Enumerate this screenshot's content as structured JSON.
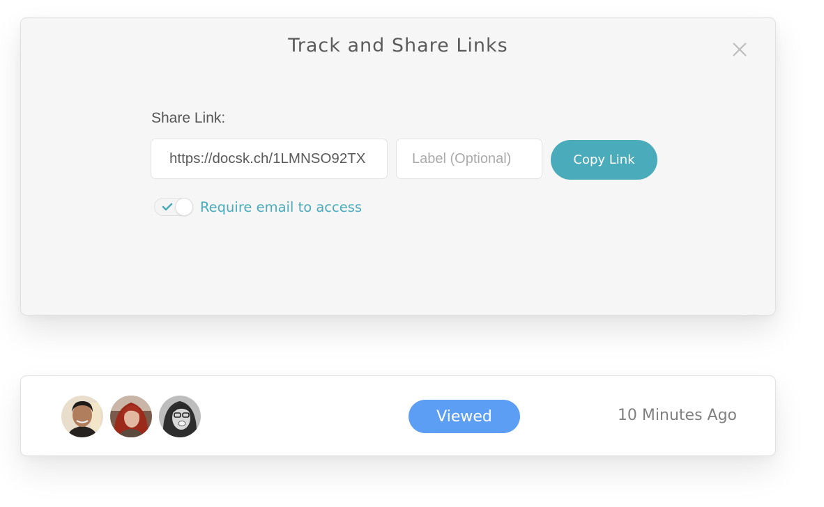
{
  "modal": {
    "title": "Track and Share Links",
    "close_icon": "close-icon",
    "share_label": "Share Link:",
    "url_value": "https://docsk.ch/1LMNSO92TX",
    "label_placeholder": "Label (Optional)",
    "label_value": "",
    "copy_button": "Copy Link",
    "require_email": {
      "label": "Require email to access",
      "checked": true
    }
  },
  "activity": {
    "avatars": [
      {
        "name": "avatar-man-dark-hair"
      },
      {
        "name": "avatar-woman-red-hair"
      },
      {
        "name": "avatar-woman-glasses"
      }
    ],
    "status": "Viewed",
    "time": "10 Minutes Ago"
  },
  "colors": {
    "accent": "#4aabbb",
    "badge": "#5d9ef5"
  }
}
